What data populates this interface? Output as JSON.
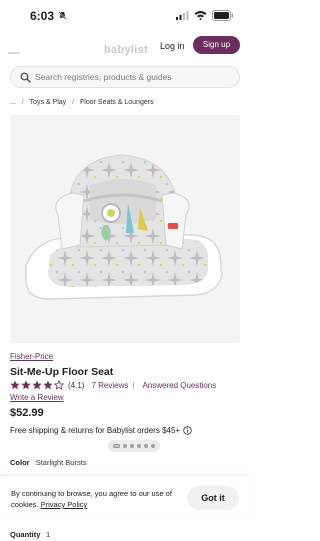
{
  "status_bar": {
    "time": "6:03"
  },
  "header": {
    "login_label": "Log in",
    "signup_label": "Sign up",
    "logo_text": "babylist"
  },
  "search": {
    "placeholder": "Search registries, products & guides"
  },
  "breadcrumb": {
    "ellipsis": "...",
    "items": [
      "Toys & Play",
      "Floor Seats & Loungers"
    ]
  },
  "carousel": {
    "total": 6,
    "active_index": 0
  },
  "product": {
    "brand": "Fisher-Price",
    "title": "Sit-Me-Up Floor Seat",
    "rating": 4.1,
    "rating_text": "(4.1)",
    "reviews_label": "7 Reviews",
    "rating_separator": "|",
    "questions_label": "Answered Questions",
    "write_review_label": "Write a Review",
    "price": "$52.99",
    "shipping_text": "Free shipping & returns for Babylist orders $45+",
    "color_label": "Color",
    "color_value": "Starlight Bursts",
    "quantity_label": "Quantity",
    "quantity_value": "1"
  },
  "cookie": {
    "text_before": "By continuing to browse, you agree to our use of cookies.",
    "privacy_label": "Privacy Policy",
    "button_label": "Got it"
  },
  "colors": {
    "brand": "#6b2e5e",
    "star": "#6b2e5e",
    "text": "#1f1f1f",
    "muted_bg": "#f4f4f4"
  },
  "icons": [
    "bell-slash-icon",
    "signal-icon",
    "wifi-icon",
    "battery-icon",
    "search-icon",
    "star-icon",
    "info-icon"
  ]
}
